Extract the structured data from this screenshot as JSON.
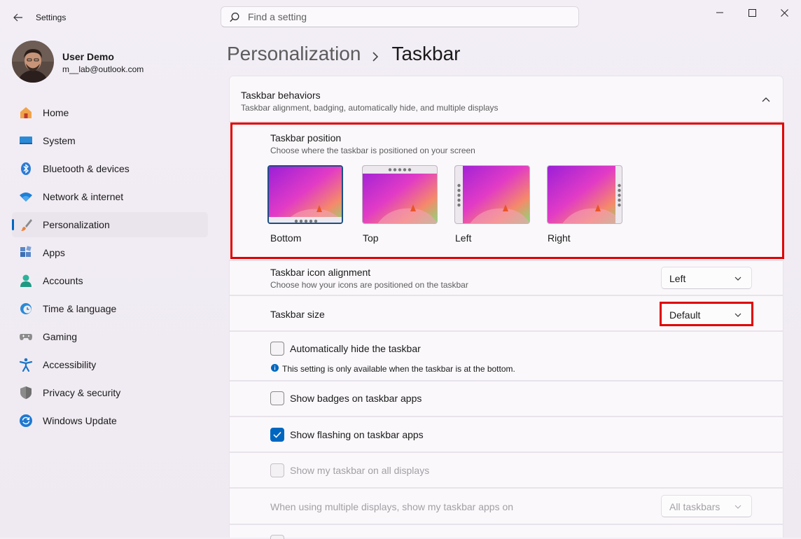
{
  "window": {
    "app_title": "Settings",
    "controls": [
      "minimize-icon",
      "maximize-icon",
      "close-icon"
    ]
  },
  "search": {
    "placeholder": "Find a setting",
    "value": ""
  },
  "profile": {
    "name": "User Demo",
    "email": "m__lab@outlook.com"
  },
  "sidebar": {
    "items": [
      {
        "label": "Home",
        "icon": "home-icon"
      },
      {
        "label": "System",
        "icon": "system-icon"
      },
      {
        "label": "Bluetooth & devices",
        "icon": "bluetooth-icon"
      },
      {
        "label": "Network & internet",
        "icon": "wifi-icon"
      },
      {
        "label": "Personalization",
        "icon": "brush-icon",
        "selected": true
      },
      {
        "label": "Apps",
        "icon": "apps-icon"
      },
      {
        "label": "Accounts",
        "icon": "person-icon"
      },
      {
        "label": "Time & language",
        "icon": "clock-globe-icon"
      },
      {
        "label": "Gaming",
        "icon": "gamepad-icon"
      },
      {
        "label": "Accessibility",
        "icon": "accessibility-icon"
      },
      {
        "label": "Privacy & security",
        "icon": "shield-icon"
      },
      {
        "label": "Windows Update",
        "icon": "update-icon"
      }
    ]
  },
  "breadcrumb": {
    "parent": "Personalization",
    "current": "Taskbar"
  },
  "behaviors": {
    "title": "Taskbar behaviors",
    "description": "Taskbar alignment, badging, automatically hide, and multiple displays",
    "expanded": true
  },
  "position": {
    "title": "Taskbar position",
    "description": "Choose where the taskbar is positioned on your screen",
    "options": [
      {
        "label": "Bottom",
        "selected": true
      },
      {
        "label": "Top",
        "selected": false
      },
      {
        "label": "Left",
        "selected": false
      },
      {
        "label": "Right",
        "selected": false
      }
    ]
  },
  "alignment": {
    "title": "Taskbar icon alignment",
    "description": "Choose how your icons are positioned on the taskbar",
    "value": "Left"
  },
  "size": {
    "title": "Taskbar size",
    "value": "Default"
  },
  "autohide": {
    "label": "Automatically hide the taskbar",
    "checked": false,
    "note": "This setting is only available when the taskbar is at the bottom."
  },
  "badges": {
    "label": "Show badges on taskbar apps",
    "checked": false
  },
  "flashing": {
    "label": "Show flashing on taskbar apps",
    "checked": true
  },
  "all_displays": {
    "label": "Show my taskbar on all displays",
    "checked": false,
    "disabled": true
  },
  "multi_display": {
    "label": "When using multiple displays, show my taskbar apps on",
    "value": "All taskbars",
    "disabled": true
  },
  "colors": {
    "accent": "#0067c0",
    "highlight": "#e00000",
    "selected_nav_bg": "#eae4ed"
  }
}
